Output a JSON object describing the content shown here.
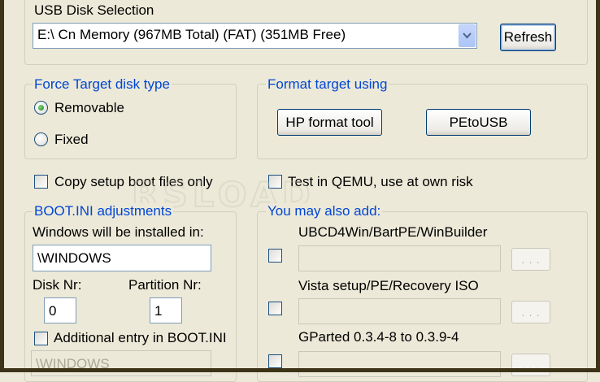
{
  "usb_disk": {
    "legend": "USB Disk Selection",
    "selected_disk": "E:\\ Cn Memory (967MB Total) (FAT) (351MB Free)",
    "refresh_label": "Refresh"
  },
  "force_target": {
    "legend": "Force Target disk type",
    "options": [
      {
        "label": "Removable",
        "selected": true
      },
      {
        "label": "Fixed",
        "selected": false
      }
    ]
  },
  "format_target": {
    "legend": "Format target using",
    "hp_label": "HP format tool",
    "petousb_label": "PEtoUSB"
  },
  "copy_setup_label": "Copy setup boot files only",
  "test_qemu_label": "Test in QEMU, use at own risk",
  "watermark_text": "RSLOAD",
  "boot_ini": {
    "legend": "BOOT.INI adjustments",
    "windows_installed_label": "Windows will be installed in:",
    "windows_path": "\\WINDOWS",
    "disk_nr_label": "Disk Nr:",
    "disk_nr_value": "0",
    "partition_nr_label": "Partition Nr:",
    "partition_nr_value": "1",
    "additional_entry_label": "Additional entry in BOOT.INI",
    "additional_path": "\\WINDOWS"
  },
  "also_add": {
    "legend": "You may also add:",
    "items": [
      {
        "label": "UBCD4Win/BartPE/WinBuilder",
        "browse": ". . ."
      },
      {
        "label": "Vista setup/PE/Recovery ISO",
        "browse": ". . ."
      },
      {
        "label": "GParted 0.3.4-8 to 0.3.9-4",
        "browse": ". . ."
      }
    ]
  },
  "colors": {
    "window_bg": "#ece9d8",
    "group_legend_blue": "#0046d5",
    "radio_selected": "#21a121"
  }
}
